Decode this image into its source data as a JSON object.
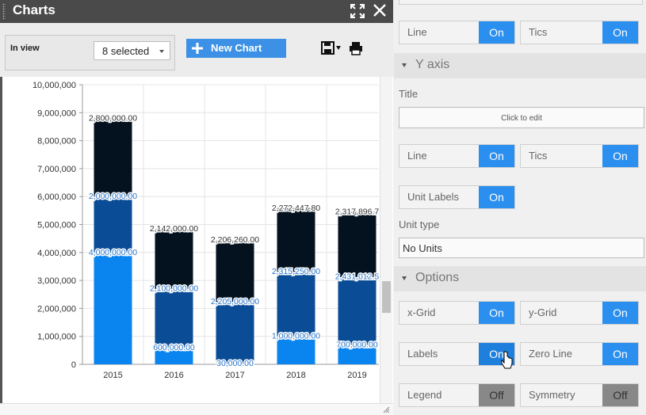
{
  "window": {
    "title": "Charts"
  },
  "toolbar": {
    "in_view_label": "In view",
    "series_select": "8 selected",
    "new_chart_label": "New Chart"
  },
  "chart_data": {
    "type": "bar",
    "stacked": true,
    "categories": [
      "2015",
      "2016",
      "2017",
      "2018",
      "2019"
    ],
    "series": [
      {
        "color": "#0a84ee",
        "values": [
          4000000,
          600000,
          30000,
          1000000,
          700000
        ]
      },
      {
        "color": "#0a4d96",
        "values": [
          2000000,
          2100000,
          2205000,
          2315250,
          2431012.5
        ]
      },
      {
        "color": "#041220",
        "values": [
          2800000,
          2142000,
          2206260,
          2272447.8,
          2317896.7
        ]
      }
    ],
    "data_labels": [
      [
        "4,000,000.00",
        "600,000.00",
        "30,000.00",
        "1,000,000.00",
        "700,000.00"
      ],
      [
        "2,000,000.00",
        "2,100,000.00",
        "2,205,000.00",
        "2,315,250.00",
        "2,431,012.5"
      ],
      [
        "2,800,000.00",
        "2,142,000.00",
        "2,206,260.00",
        "2,272,447.80",
        "2,317,896.7"
      ]
    ],
    "ylim": [
      0,
      10000000
    ],
    "yticks": [
      "0",
      "1,000,000",
      "2,000,000",
      "3,000,000",
      "4,000,000",
      "5,000,000",
      "6,000,000",
      "7,000,000",
      "8,000,000",
      "9,000,000",
      "10,000,000"
    ],
    "grid": true
  },
  "panel": {
    "line_label": "Line",
    "line_value": "On",
    "tics_label": "Tics",
    "tics_value": "On",
    "y_axis_section": "Y axis",
    "title_label": "Title",
    "title_placeholder": "Click to edit",
    "y_line_label": "Line",
    "y_line_value": "On",
    "y_tics_label": "Tics",
    "y_tics_value": "On",
    "unit_labels_label": "Unit Labels",
    "unit_labels_value": "On",
    "unit_type_label": "Unit type",
    "unit_type_value": "No Units",
    "options_section": "Options",
    "xgrid_label": "x-Grid",
    "xgrid_value": "On",
    "ygrid_label": "y-Grid",
    "ygrid_value": "On",
    "labels_label": "Labels",
    "labels_value": "On",
    "zero_line_label": "Zero Line",
    "zero_line_value": "On",
    "legend_label": "Legend",
    "legend_value": "Off",
    "symmetry_label": "Symmetry",
    "symmetry_value": "Off"
  },
  "colors": {
    "accent": "#2b8fef",
    "title_bar": "#4a4a4a",
    "toggle_off": "#888888"
  }
}
